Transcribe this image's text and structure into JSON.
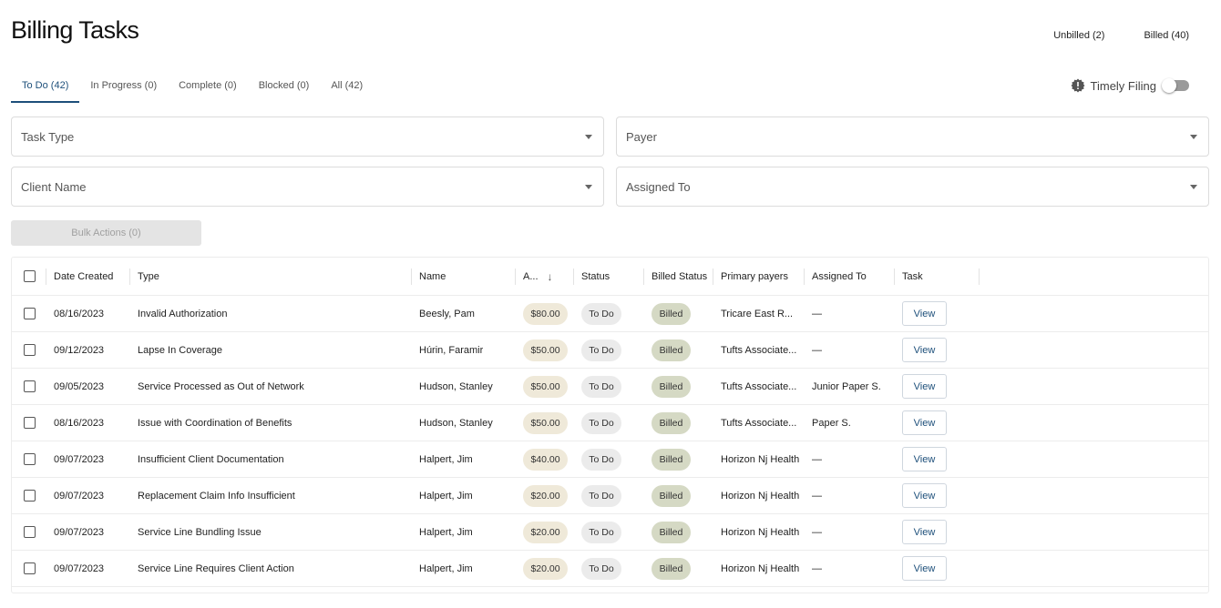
{
  "page": {
    "title": "Billing Tasks"
  },
  "top_tabs": [
    {
      "label": "Unbilled (2)"
    },
    {
      "label": "Billed (40)"
    }
  ],
  "status_tabs": [
    {
      "label": "To Do (42)",
      "active": true
    },
    {
      "label": "In Progress (0)"
    },
    {
      "label": "Complete (0)"
    },
    {
      "label": "Blocked (0)"
    },
    {
      "label": "All (42)"
    }
  ],
  "timely_filing": {
    "label": "Timely Filing",
    "icon": "gear-alert-icon",
    "enabled": false
  },
  "filters": {
    "task_type": "Task Type",
    "payer": "Payer",
    "client_name": "Client Name",
    "assigned_to": "Assigned To"
  },
  "bulk_actions": "Bulk Actions (0)",
  "table": {
    "columns": {
      "date": "Date Created",
      "type": "Type",
      "name": "Name",
      "amount": "A...",
      "status": "Status",
      "billed": "Billed Status",
      "payer": "Primary payers",
      "assigned": "Assigned To",
      "task": "Task"
    },
    "rows": [
      {
        "date": "08/16/2023",
        "type": "Invalid Authorization",
        "name": "Beesly, Pam",
        "amount": "$80.00",
        "status": "To Do",
        "billed": "Billed",
        "payer": "Tricare East R...",
        "assigned": "—",
        "task": "View"
      },
      {
        "date": "09/12/2023",
        "type": "Lapse In Coverage",
        "name": "Húrin, Faramir",
        "amount": "$50.00",
        "status": "To Do",
        "billed": "Billed",
        "payer": "Tufts Associate...",
        "assigned": "—",
        "task": "View"
      },
      {
        "date": "09/05/2023",
        "type": "Service Processed as Out of Network",
        "name": "Hudson, Stanley",
        "amount": "$50.00",
        "status": "To Do",
        "billed": "Billed",
        "payer": "Tufts Associate...",
        "assigned": "Junior Paper S.",
        "task": "View"
      },
      {
        "date": "08/16/2023",
        "type": "Issue with Coordination of Benefits",
        "name": "Hudson, Stanley",
        "amount": "$50.00",
        "status": "To Do",
        "billed": "Billed",
        "payer": "Tufts Associate...",
        "assigned": "Paper S.",
        "task": "View"
      },
      {
        "date": "09/07/2023",
        "type": "Insufficient Client Documentation",
        "name": "Halpert, Jim",
        "amount": "$40.00",
        "status": "To Do",
        "billed": "Billed",
        "payer": "Horizon Nj Health",
        "assigned": "—",
        "task": "View"
      },
      {
        "date": "09/07/2023",
        "type": "Replacement Claim Info Insufficient",
        "name": "Halpert, Jim",
        "amount": "$20.00",
        "status": "To Do",
        "billed": "Billed",
        "payer": "Horizon Nj Health",
        "assigned": "—",
        "task": "View"
      },
      {
        "date": "09/07/2023",
        "type": "Service Line Bundling Issue",
        "name": "Halpert, Jim",
        "amount": "$20.00",
        "status": "To Do",
        "billed": "Billed",
        "payer": "Horizon Nj Health",
        "assigned": "—",
        "task": "View"
      },
      {
        "date": "09/07/2023",
        "type": "Service Line Requires Client Action",
        "name": "Halpert, Jim",
        "amount": "$20.00",
        "status": "To Do",
        "billed": "Billed",
        "payer": "Horizon Nj Health",
        "assigned": "—",
        "task": "View"
      }
    ]
  },
  "colors": {
    "accent": "#1d4f7a",
    "amount_pill": "#efe9d9",
    "status_pill": "#ebebeb",
    "billed_pill": "#d5d9c4"
  }
}
